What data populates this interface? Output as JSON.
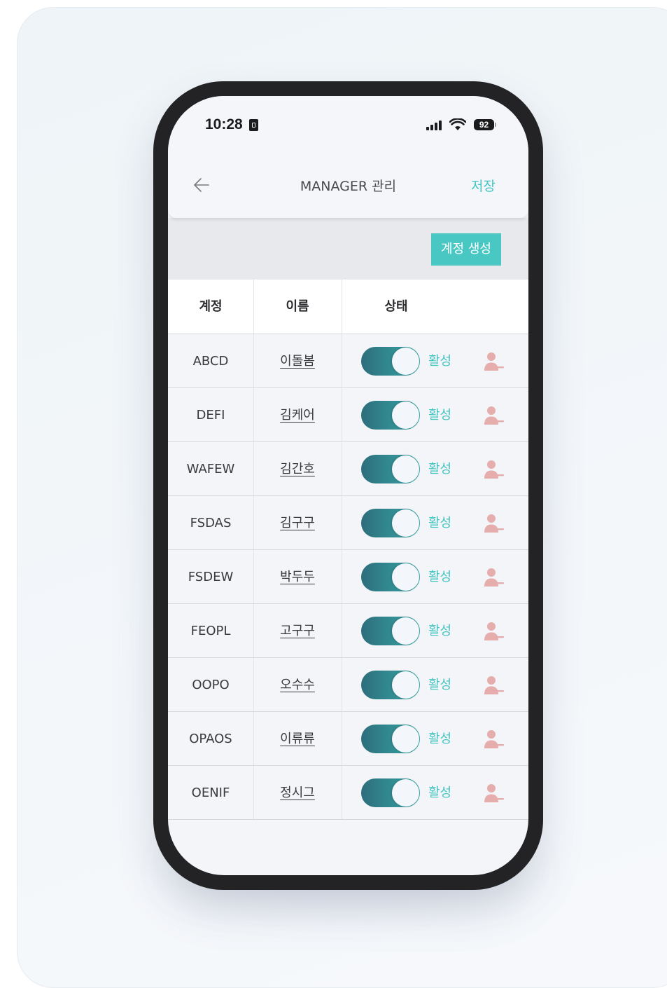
{
  "status_bar": {
    "time": "10:28",
    "battery": "92"
  },
  "header": {
    "title": "MANAGER 관리",
    "save_label": "저장",
    "back_icon": "arrow-left-icon"
  },
  "actions": {
    "create_account_label": "계정 생성"
  },
  "table": {
    "headers": {
      "account": "계정",
      "name": "이름",
      "status": "상태"
    },
    "rows": [
      {
        "account": "ABCD",
        "name": "이돌봄",
        "status": "활성",
        "active": true
      },
      {
        "account": "DEFI",
        "name": "김케어",
        "status": "활성",
        "active": true
      },
      {
        "account": "WAFEW",
        "name": "김간호",
        "status": "활성",
        "active": true
      },
      {
        "account": "FSDAS",
        "name": "김구구",
        "status": "활성",
        "active": true
      },
      {
        "account": "FSDEW",
        "name": "박두두",
        "status": "활성",
        "active": true
      },
      {
        "account": "FEOPL",
        "name": "고구구",
        "status": "활성",
        "active": true
      },
      {
        "account": "OOPO",
        "name": "오수수",
        "status": "활성",
        "active": true
      },
      {
        "account": "OPAOS",
        "name": "이류류",
        "status": "활성",
        "active": true
      },
      {
        "account": "OENIF",
        "name": "정시그",
        "status": "활성",
        "active": true
      }
    ]
  },
  "colors": {
    "accent": "#48c7c3",
    "toggle_start": "#2d6e7c",
    "toggle_end": "#37a7a6",
    "remove_icon": "#e3a7a7"
  }
}
